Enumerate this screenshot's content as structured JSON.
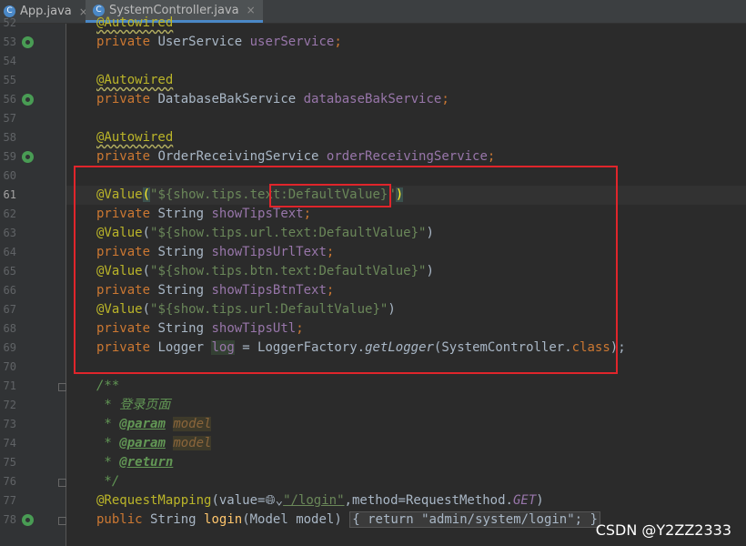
{
  "tabs": [
    {
      "label": "App.java",
      "icon": "java-class-icon",
      "close": "×"
    },
    {
      "label": "SystemController.java",
      "icon": "java-class-icon",
      "close": "×"
    }
  ],
  "lines": {
    "l52": {
      "num": "52",
      "ann": "@Autowired"
    },
    "l53": {
      "num": "53",
      "kw": "private",
      "type": "UserService",
      "field": "userService",
      "semi": ";"
    },
    "l54": {
      "num": "54"
    },
    "l55": {
      "num": "55",
      "ann": "@Autowired"
    },
    "l56": {
      "num": "56",
      "kw": "private",
      "type": "DatabaseBakService",
      "field": "databaseBakService",
      "semi": ";"
    },
    "l57": {
      "num": "57"
    },
    "l58": {
      "num": "58",
      "ann": "@Autowired"
    },
    "l59": {
      "num": "59",
      "kw": "private",
      "type": "OrderReceivingService",
      "field": "orderReceivingService",
      "semi": ";"
    },
    "l60": {
      "num": "60"
    },
    "l61": {
      "num": "61",
      "ann": "@Value",
      "open": "(",
      "str": "\"${show.tips.text:DefaultValue}\"",
      "close": ")"
    },
    "l62": {
      "num": "62",
      "kw": "private",
      "type": "String",
      "field": "showTipsText",
      "semi": ";"
    },
    "l63": {
      "num": "63",
      "ann": "@Value",
      "open": "(",
      "str": "\"${show.tips.url.text:DefaultValue}\"",
      "close": ")"
    },
    "l64": {
      "num": "64",
      "kw": "private",
      "type": "String",
      "field": "showTipsUrlText",
      "semi": ";"
    },
    "l65": {
      "num": "65",
      "ann": "@Value",
      "open": "(",
      "str": "\"${show.tips.btn.text:DefaultValue}\"",
      "close": ")"
    },
    "l66": {
      "num": "66",
      "kw": "private",
      "type": "String",
      "field": "showTipsBtnText",
      "semi": ";"
    },
    "l67": {
      "num": "67",
      "ann": "@Value",
      "open": "(",
      "str": "\"${show.tips.url:DefaultValue}\"",
      "close": ")"
    },
    "l68": {
      "num": "68",
      "kw": "private",
      "type": "String",
      "field": "showTipsUtl",
      "semi": ";"
    },
    "l69": {
      "num": "69",
      "kw": "private",
      "type": "Logger",
      "field": "log",
      "eq": " = LoggerFactory.",
      "meth": "getLogger",
      "args": "(SystemController.",
      "cls": "class",
      "end": ");"
    },
    "l70": {
      "num": "70"
    },
    "l71": {
      "num": "71",
      "cmt": "/**"
    },
    "l72": {
      "num": "72",
      "cmt": " * 登录页面"
    },
    "l73": {
      "num": "73",
      "star": " * ",
      "tag": "@param",
      "arg": "model"
    },
    "l74": {
      "num": "74",
      "star": " * ",
      "tag": "@param",
      "arg": "model"
    },
    "l75": {
      "num": "75",
      "star": " * ",
      "tag": "@return"
    },
    "l76": {
      "num": "76",
      "cmt": " */"
    },
    "l77": {
      "num": "77",
      "ann": "@RequestMapping",
      "p1": "(value=",
      "globe": "🌐︎⌄",
      "str": "\"/login\"",
      "p2": ",method=RequestMethod.",
      "constant": "GET",
      "p3": ")"
    },
    "l78": {
      "num": "78",
      "kw": "public",
      "type": "String",
      "meth": "login",
      "p1": "(Model ",
      "param": "model",
      "p2": ")",
      "fold": "{ return \"admin/system/login\"; }"
    }
  },
  "watermark": "CSDN @Y2ZZ2333"
}
